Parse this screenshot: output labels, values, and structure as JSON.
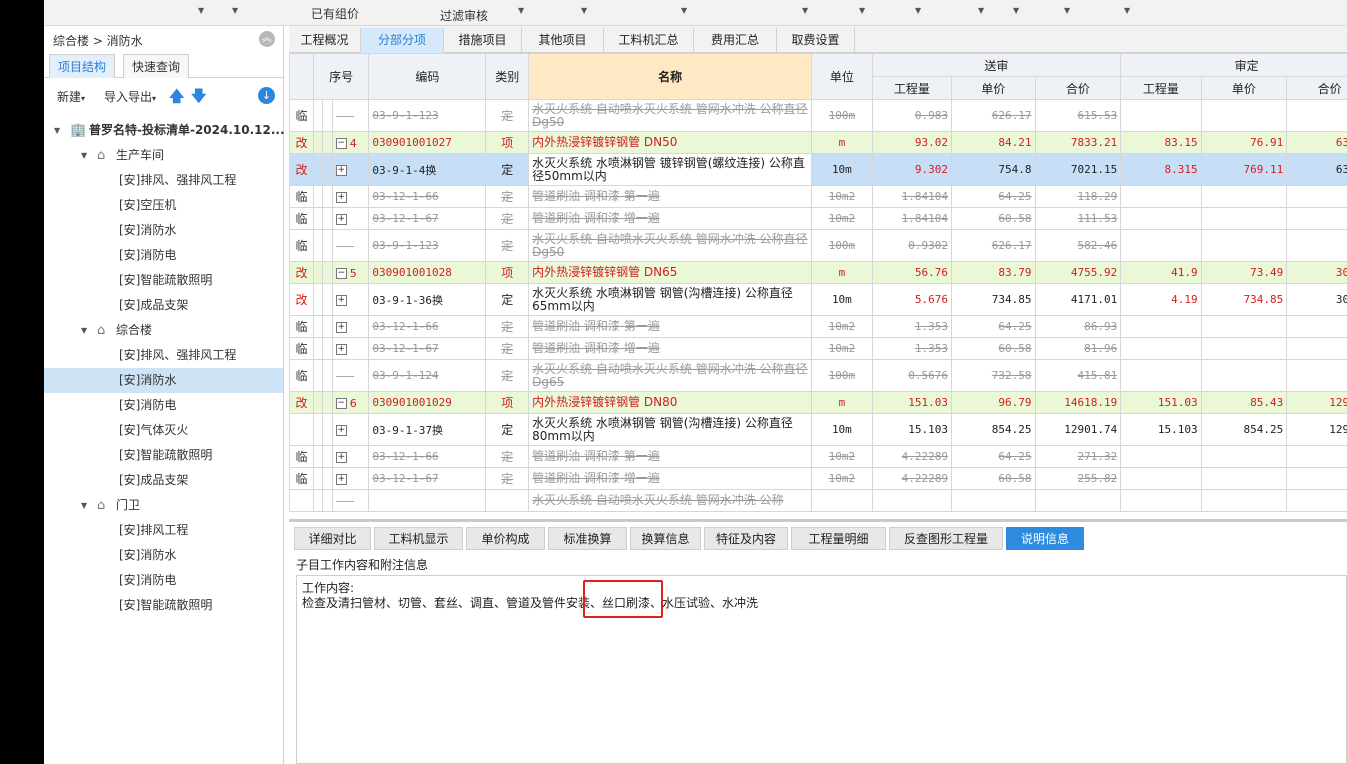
{
  "topbar": {
    "label1": "已有组价",
    "label2": "过滤审核"
  },
  "left": {
    "breadcrumb": "综合楼 > 消防水",
    "tabs": [
      "项目结构",
      "快速查询"
    ],
    "tools": {
      "new": "新建",
      "import": "导入导出"
    },
    "tree": [
      {
        "level": 0,
        "icon": "building-icon",
        "label": "普罗名特-投标清单-2024.10.12...",
        "twisty": "▼"
      },
      {
        "level": 1,
        "icon": "home-icon",
        "label": "生产车间",
        "twisty": "▼"
      },
      {
        "level": 2,
        "label": "[安]排风、强排风工程"
      },
      {
        "level": 2,
        "label": "[安]空压机"
      },
      {
        "level": 2,
        "label": "[安]消防水"
      },
      {
        "level": 2,
        "label": "[安]消防电"
      },
      {
        "level": 2,
        "label": "[安]智能疏散照明"
      },
      {
        "level": 2,
        "label": "[安]成品支架"
      },
      {
        "level": 1,
        "icon": "home-icon",
        "label": "综合楼",
        "twisty": "▼"
      },
      {
        "level": 2,
        "label": "[安]排风、强排风工程"
      },
      {
        "level": 2,
        "label": "[安]消防水",
        "selected": true
      },
      {
        "level": 2,
        "label": "[安]消防电"
      },
      {
        "level": 2,
        "label": "[安]气体灭火"
      },
      {
        "level": 2,
        "label": "[安]智能疏散照明"
      },
      {
        "level": 2,
        "label": "[安]成品支架"
      },
      {
        "level": 1,
        "icon": "home-icon",
        "label": "门卫",
        "twisty": "▼"
      },
      {
        "level": 2,
        "label": "[安]排风工程"
      },
      {
        "level": 2,
        "label": "[安]消防水"
      },
      {
        "level": 2,
        "label": "[安]消防电"
      },
      {
        "level": 2,
        "label": "[安]智能疏散照明"
      }
    ]
  },
  "tabs": [
    "工程概况",
    "分部分项",
    "措施项目",
    "其他项目",
    "工料机汇总",
    "费用汇总",
    "取费设置"
  ],
  "active_tab": "分部分项",
  "grid": {
    "headers": {
      "seq": "序号",
      "code": "编码",
      "type": "类别",
      "name": "名称",
      "unit": "单位",
      "group1": "送审",
      "group2": "审定",
      "qty": "工程量",
      "price": "单价",
      "total": "合价"
    },
    "rows": [
      {
        "flag": "临",
        "tree": "leaf",
        "code": "03-9-1-123",
        "type": "定",
        "name": "水灭火系统 自动喷水灭火系统 管网水冲洗 公称直径Dg50",
        "unit": "100m",
        "q1": "0.983",
        "p1": "626.17",
        "t1": "615.53",
        "q2": "",
        "p2": "",
        "t2": "",
        "style": "strike"
      },
      {
        "flag": "改",
        "tree": "minus",
        "seq": "4",
        "code": "030901001027",
        "type": "项",
        "name": "内外热浸锌镀锌钢管 DN50",
        "unit": "m",
        "q1": "93.02",
        "p1": "84.21",
        "t1": "7833.21",
        "q2": "83.15",
        "p2": "76.91",
        "t2": "6395.",
        "style": "green"
      },
      {
        "flag": "改",
        "tree": "plus",
        "code": "03-9-1-4换",
        "type": "定",
        "name": "水灭火系统 水喷淋钢管 镀锌钢管(螺纹连接) 公称直径50mm以内",
        "unit": "10m",
        "q1": "9.302",
        "p1": "754.8",
        "t1": "7021.15",
        "q2": "8.315",
        "p2": "769.11",
        "t2": "6395.",
        "style": "sel"
      },
      {
        "flag": "临",
        "tree": "plus",
        "code": "03-12-1-66",
        "type": "定",
        "name": "管道刷油 调和漆 第一遍",
        "unit": "10m2",
        "q1": "1.84104",
        "p1": "64.25",
        "t1": "118.29",
        "q2": "",
        "p2": "",
        "t2": "",
        "style": "strike"
      },
      {
        "flag": "临",
        "tree": "plus",
        "code": "03-12-1-67",
        "type": "定",
        "name": "管道刷油 调和漆 增一遍",
        "unit": "10m2",
        "q1": "1.84104",
        "p1": "60.58",
        "t1": "111.53",
        "q2": "",
        "p2": "",
        "t2": "",
        "style": "strike"
      },
      {
        "flag": "临",
        "tree": "leaf",
        "code": "03-9-1-123",
        "type": "定",
        "name": "水灭火系统 自动喷水灭火系统 管网水冲洗 公称直径Dg50",
        "unit": "100m",
        "q1": "0.9302",
        "p1": "626.17",
        "t1": "582.46",
        "q2": "",
        "p2": "",
        "t2": "",
        "style": "strike"
      },
      {
        "flag": "改",
        "tree": "minus",
        "seq": "5",
        "code": "030901001028",
        "type": "项",
        "name": "内外热浸锌镀锌钢管 DN65",
        "unit": "m",
        "q1": "56.76",
        "p1": "83.79",
        "t1": "4755.92",
        "q2": "41.9",
        "p2": "73.49",
        "t2": "3079.",
        "style": "green"
      },
      {
        "flag": "改",
        "tree": "plus",
        "code": "03-9-1-36换",
        "type": "定",
        "name": "水灭火系统 水喷淋钢管 钢管(沟槽连接) 公称直径65mm以内",
        "unit": "10m",
        "q1": "5.676",
        "p1": "734.85",
        "t1": "4171.01",
        "q2": "4.19",
        "p2": "734.85",
        "t2": "3079.",
        "style": "normal"
      },
      {
        "flag": "临",
        "tree": "plus",
        "code": "03-12-1-66",
        "type": "定",
        "name": "管道刷油 调和漆 第一遍",
        "unit": "10m2",
        "q1": "1.353",
        "p1": "64.25",
        "t1": "86.93",
        "q2": "",
        "p2": "",
        "t2": "",
        "style": "strike"
      },
      {
        "flag": "临",
        "tree": "plus",
        "code": "03-12-1-67",
        "type": "定",
        "name": "管道刷油 调和漆 增一遍",
        "unit": "10m2",
        "q1": "1.353",
        "p1": "60.58",
        "t1": "81.96",
        "q2": "",
        "p2": "",
        "t2": "",
        "style": "strike"
      },
      {
        "flag": "临",
        "tree": "leaf",
        "code": "03-9-1-124",
        "type": "定",
        "name": "水灭火系统 自动喷水灭火系统 管网水冲洗 公称直径Dg65",
        "unit": "100m",
        "q1": "0.5676",
        "p1": "732.58",
        "t1": "415.81",
        "q2": "",
        "p2": "",
        "t2": "",
        "style": "strike"
      },
      {
        "flag": "改",
        "tree": "minus",
        "seq": "6",
        "code": "030901001029",
        "type": "项",
        "name": "内外热浸锌镀锌钢管 DN80",
        "unit": "m",
        "q1": "151.03",
        "p1": "96.79",
        "t1": "14618.19",
        "q2": "151.03",
        "p2": "85.43",
        "t2": "12902.",
        "style": "green"
      },
      {
        "flag": "",
        "tree": "plus",
        "code": "03-9-1-37换",
        "type": "定",
        "name": "水灭火系统 水喷淋钢管 钢管(沟槽连接) 公称直径80mm以内",
        "unit": "10m",
        "q1": "15.103",
        "p1": "854.25",
        "t1": "12901.74",
        "q2": "15.103",
        "p2": "854.25",
        "t2": "12901.",
        "style": "normal"
      },
      {
        "flag": "临",
        "tree": "plus",
        "code": "03-12-1-66",
        "type": "定",
        "name": "管道刷油 调和漆 第一遍",
        "unit": "10m2",
        "q1": "4.22289",
        "p1": "64.25",
        "t1": "271.32",
        "q2": "",
        "p2": "",
        "t2": "",
        "style": "strike"
      },
      {
        "flag": "临",
        "tree": "plus",
        "code": "03-12-1-67",
        "type": "定",
        "name": "管道刷油 调和漆 增一遍",
        "unit": "10m2",
        "q1": "4.22289",
        "p1": "60.58",
        "t1": "255.82",
        "q2": "",
        "p2": "",
        "t2": "",
        "style": "strike"
      },
      {
        "flag": "",
        "tree": "leaf",
        "code": "",
        "type": "",
        "name": "水灭火系统 自动喷水灭火系统 管网水冲洗 公称",
        "unit": "",
        "q1": "",
        "p1": "",
        "t1": "",
        "q2": "",
        "p2": "",
        "t2": "",
        "style": "strike"
      }
    ]
  },
  "bottom": {
    "tabs": [
      "详细对比",
      "工料机显示",
      "单价构成",
      "标准换算",
      "换算信息",
      "特征及内容",
      "工程量明细",
      "反查图形工程量",
      "说明信息"
    ],
    "active": "说明信息",
    "subtitle": "子目工作内容和附注信息",
    "content_title": "工作内容:",
    "content": "检查及清扫管材、切管、套丝、调直、管道及管件安装、丝口刷漆、水压试验、水冲洗"
  },
  "colors": {
    "accent": "#2f8be0",
    "change_flag": "#d21e1e",
    "highlight_box": "#e02020",
    "group_row": "#eaf8d8"
  }
}
